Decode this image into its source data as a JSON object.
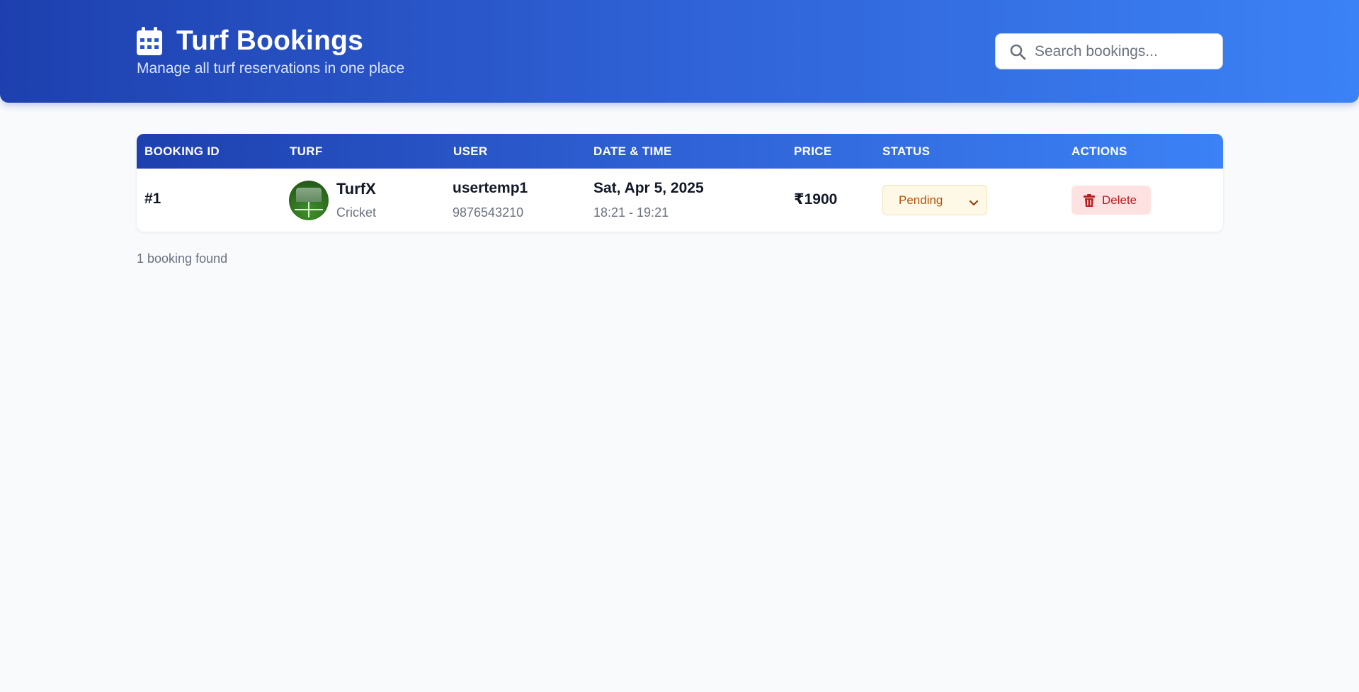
{
  "header": {
    "icon": "calendar-icon",
    "title": "Turf Bookings",
    "subtitle": "Manage all turf reservations in one place",
    "search": {
      "icon": "search-icon",
      "placeholder": "Search bookings...",
      "value": ""
    }
  },
  "table": {
    "columns": [
      "Booking ID",
      "Turf",
      "User",
      "Date & Time",
      "Price",
      "Status",
      "Actions"
    ],
    "rows": [
      {
        "id": "#1",
        "turf": {
          "name": "TurfX",
          "sport": "Cricket",
          "image": "cricket-turf-thumbnail"
        },
        "user": {
          "name": "usertemp1",
          "phone": "9876543210"
        },
        "date": "Sat, Apr 5, 2025",
        "time": "18:21 - 19:21",
        "price": "₹1900",
        "status": "Pending",
        "action": {
          "label": "Delete",
          "icon": "trash-icon"
        }
      }
    ]
  },
  "footer": {
    "count_text": "1 booking found"
  },
  "colors": {
    "header_gradient_start": "#1e40af",
    "header_gradient_end": "#3b82f6",
    "page_bg": "#f8fafc",
    "status_pending_bg": "#fef9e7",
    "status_pending_text": "#b45309",
    "delete_bg": "#fee2e2",
    "delete_text": "#b91c1c"
  }
}
